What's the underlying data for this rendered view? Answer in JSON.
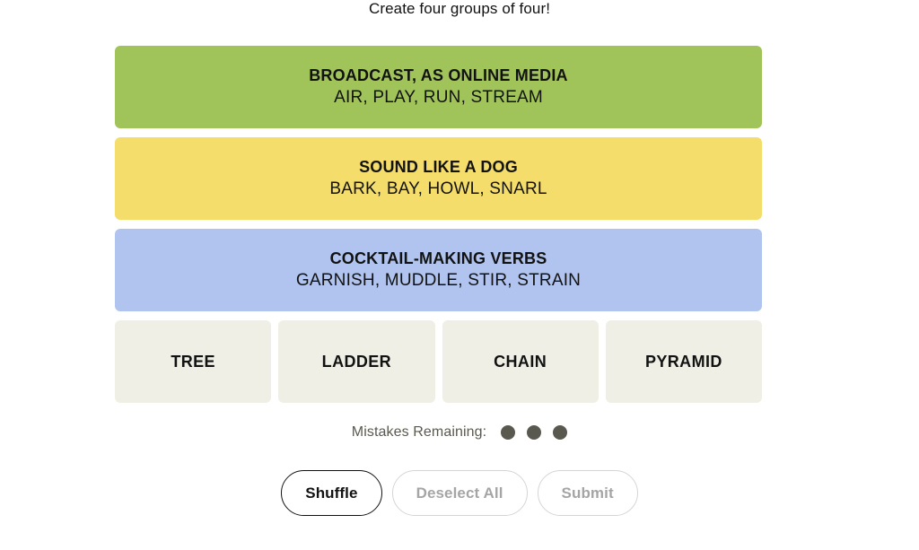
{
  "game": {
    "title": "Create four groups of four!"
  },
  "solved_groups": [
    {
      "category": "BROADCAST, AS ONLINE MEDIA",
      "members": "AIR, PLAY, RUN, STREAM",
      "color": "#a0c35a",
      "difficulty": "green"
    },
    {
      "category": "SOUND LIKE A DOG",
      "members": "BARK, BAY, HOWL, SNARL",
      "color": "#f5dd6b",
      "difficulty": "yellow"
    },
    {
      "category": "COCKTAIL-MAKING VERBS",
      "members": "GARNISH, MUDDLE, STIR, STRAIN",
      "color": "#b0c4ef",
      "difficulty": "blue"
    }
  ],
  "remaining_tiles": [
    {
      "word": "TREE"
    },
    {
      "word": "LADDER"
    },
    {
      "word": "CHAIN"
    },
    {
      "word": "PYRAMID"
    }
  ],
  "mistakes": {
    "label": "Mistakes Remaining:",
    "count": 3,
    "dot_color": "#5a5950"
  },
  "controls": [
    {
      "label": "Shuffle",
      "state": "enabled"
    },
    {
      "label": "Deselect All",
      "state": "disabled"
    },
    {
      "label": "Submit",
      "state": "disabled"
    }
  ]
}
